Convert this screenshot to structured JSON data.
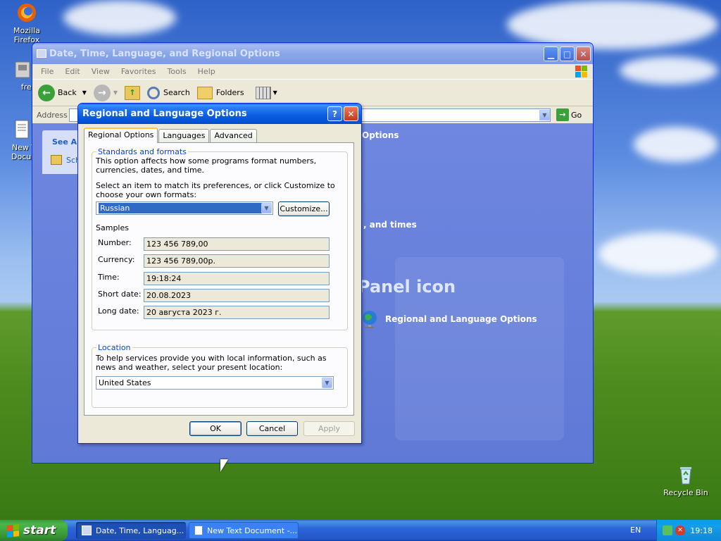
{
  "desktop": {
    "icons": [
      {
        "label": "Mozilla Firefox"
      },
      {
        "label": "freev"
      },
      {
        "label": "New T Docum"
      },
      {
        "label": "Recycle Bin"
      }
    ]
  },
  "explorer": {
    "title": "Date, Time, Language, and Regional Options",
    "menu": [
      "File",
      "Edit",
      "View",
      "Favorites",
      "Tools",
      "Help"
    ],
    "toolbar": {
      "back": "Back",
      "search": "Search",
      "folders": "Folders"
    },
    "address_label": "Address",
    "go_label": "Go",
    "see_also": "See Al",
    "see_also_item": "Sch",
    "body": {
      "options_text": "Options",
      "times_text": ", and times",
      "panel_icon_text": "Panel icon",
      "regional_link": "Regional and Language Options"
    }
  },
  "dialog": {
    "title": "Regional and Language Options",
    "tabs": [
      {
        "label": "Regional Options",
        "active": true
      },
      {
        "label": "Languages",
        "active": false
      },
      {
        "label": "Advanced",
        "active": false
      }
    ],
    "standards": {
      "legend": "Standards and formats",
      "desc1": "This option affects how some programs format numbers, currencies, dates, and time.",
      "desc2": "Select an item to match its preferences, or click Customize to choose your own formats:",
      "selected_format": "Russian",
      "customize_label": "Customize...",
      "samples_label": "Samples",
      "samples": [
        {
          "label": "Number:",
          "value": "123 456 789,00"
        },
        {
          "label": "Currency:",
          "value": "123 456 789,00р."
        },
        {
          "label": "Time:",
          "value": "19:18:24"
        },
        {
          "label": "Short date:",
          "value": "20.08.2023"
        },
        {
          "label": "Long date:",
          "value": "20 августа 2023 г."
        }
      ]
    },
    "location": {
      "legend": "Location",
      "desc": "To help services provide you with local information, such as news and weather, select your present location:",
      "selected_location": "United States"
    },
    "buttons": {
      "ok": "OK",
      "cancel": "Cancel",
      "apply": "Apply"
    }
  },
  "taskbar": {
    "start_label": "start",
    "tasks": [
      {
        "label": "Date, Time, Languag...",
        "active": true
      },
      {
        "label": "New Text Document -...",
        "active": false
      }
    ],
    "language": "EN",
    "clock": "19:18"
  }
}
